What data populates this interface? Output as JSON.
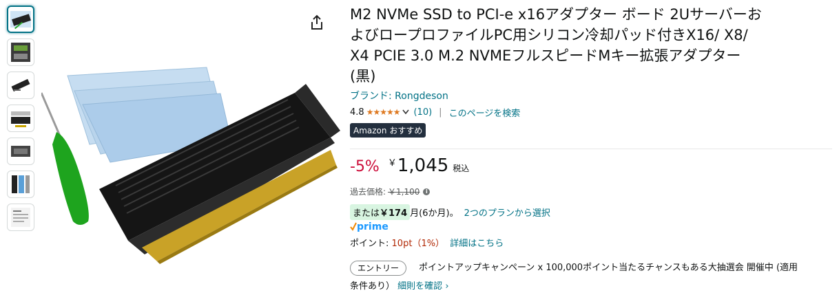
{
  "product": {
    "title": "M2 NVMe SSD to PCI-e x16アダプター ボード 2UサーバーおよびロープロファイルPC用シリコン冷却パッド付きX16/ X8/ X4 PCIE 3.0 M.2 NVMEフルスピードMキー拡張アダプター (黒)",
    "title_lines": [
      "M2 NVMe SSD to PCI-e x16アダプター ボード 2Uサーバーお",
      "よびロープロファイルPC用シリコン冷却パッド付きX16/ X8/",
      "X4 PCIE 3.0 M.2 NVMEフルスピードMキー拡張アダプター",
      "(黒)"
    ],
    "brand": "ブランド: Rongdeson",
    "rating_value": "4.8",
    "stars": "★★★★★",
    "review_count": "(10)",
    "search_page": "このページを検索",
    "badge_text": "Amazon おすすめ"
  },
  "pricing": {
    "discount": "-5%",
    "currency": "￥",
    "price": "1,045",
    "tax": "税込",
    "list_label": "過去価格:",
    "list_price": "￥1,100",
    "info_icon": "info-icon"
  },
  "installment": {
    "prefix": "または",
    "amount": "￥174",
    "term": "月(6か月)。",
    "plans_link": "2つのプランから選択"
  },
  "prime": {
    "label": "prime"
  },
  "points": {
    "label": "ポイント:",
    "value": "10pt",
    "percent": "（1%）",
    "detail_link": "詳細はこちら"
  },
  "campaign": {
    "entry_button": "エントリー",
    "text": "ポイントアップキャンペーン x 100,000ポイント当たるチャンスもある大抽選会 開催中 (適用",
    "text_cont": "条件あり）",
    "detail_link": "細則を確認"
  },
  "gallery": {
    "thumbnails": [
      "thumb-1",
      "thumb-2",
      "thumb-3",
      "thumb-4",
      "thumb-5",
      "thumb-6",
      "thumb-7"
    ]
  },
  "icons": {
    "share": "share-icon",
    "chevron": "chevron-down-icon"
  },
  "colors": {
    "link": "#007185",
    "discount": "#cc0c39",
    "star": "#de7921",
    "badge_bg": "#232f3e",
    "installment_bg": "#d8f5e1",
    "prime_blue": "#1a98ff"
  }
}
